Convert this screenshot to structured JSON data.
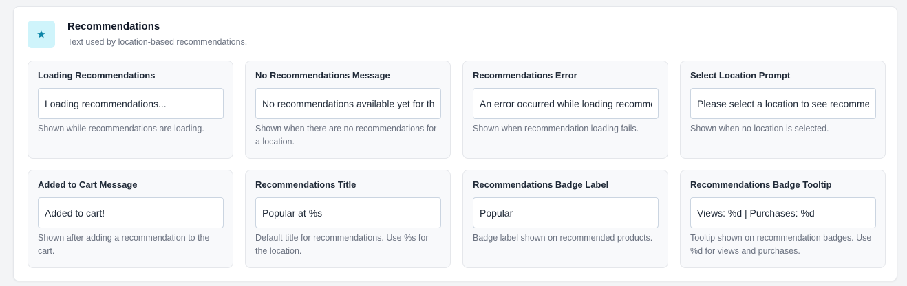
{
  "header": {
    "title": "Recommendations",
    "subtitle": "Text used by location-based recommendations.",
    "icon": "star-icon",
    "accent_color": "#0e86a8",
    "icon_bg": "#cff4fb"
  },
  "cards": [
    {
      "label": "Loading Recommendations",
      "value": "Loading recommendations...",
      "help": "Shown while recommendations are loading."
    },
    {
      "label": "No Recommendations Message",
      "value": "No recommendations available yet for this location.",
      "help": "Shown when there are no recommendations for a location."
    },
    {
      "label": "Recommendations Error",
      "value": "An error occurred while loading recommendations.",
      "help": "Shown when recommendation loading fails."
    },
    {
      "label": "Select Location Prompt",
      "value": "Please select a location to see recommendations.",
      "help": "Shown when no location is selected."
    },
    {
      "label": "Added to Cart Message",
      "value": "Added to cart!",
      "help": "Shown after adding a recommendation to the cart."
    },
    {
      "label": "Recommendations Title",
      "value": "Popular at %s",
      "help": "Default title for recommendations. Use %s for the location."
    },
    {
      "label": "Recommendations Badge Label",
      "value": "Popular",
      "help": "Badge label shown on recommended products."
    },
    {
      "label": "Recommendations Badge Tooltip",
      "value": "Views: %d | Purchases: %d",
      "help": "Tooltip shown on recommendation badges. Use %d for views and purchases."
    }
  ]
}
